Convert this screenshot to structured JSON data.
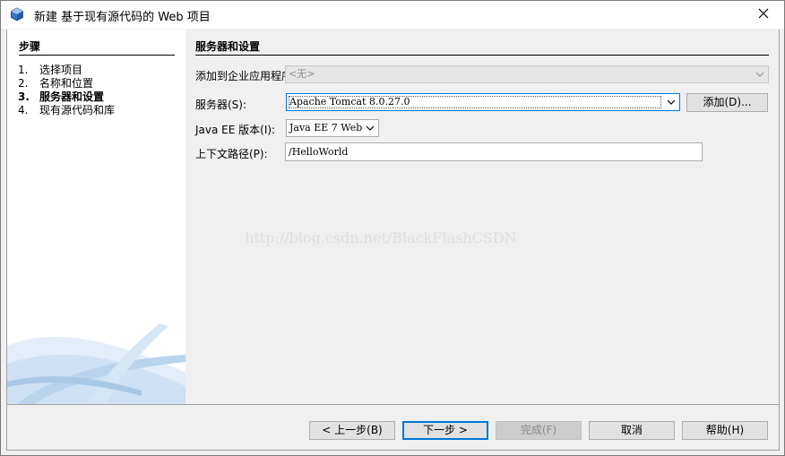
{
  "window": {
    "title": "新建 基于现有源代码的 Web 项目",
    "close_icon": "close-icon"
  },
  "steps": {
    "heading": "步骤",
    "items": [
      {
        "num": "1.",
        "label": "选择项目",
        "current": false
      },
      {
        "num": "2.",
        "label": "名称和位置",
        "current": false
      },
      {
        "num": "3.",
        "label": "服务器和设置",
        "current": true
      },
      {
        "num": "4.",
        "label": "现有源代码和库",
        "current": false
      }
    ]
  },
  "main": {
    "heading": "服务器和设置",
    "add_to_ear_label": "添加到企业应用程序(A):",
    "add_to_ear_value": "<无>",
    "server_label": "服务器(S):",
    "server_value": "Apache Tomcat 8.0.27.0",
    "add_button": "添加(D)...",
    "javaee_label": "Java EE 版本(I):",
    "javaee_value": "Java EE 7 Web",
    "context_label": "上下文路径(P):",
    "context_value": "/HelloWorld"
  },
  "watermark": "http://blog.csdn.net/BlackFlashCSDN",
  "footer": {
    "back": "< 上一步(B)",
    "next": "下一步 >",
    "finish": "完成(F)",
    "cancel": "取消",
    "help": "帮助(H)"
  },
  "colors": {
    "focus_border": "#0078d7",
    "panel_bg": "#f0f0f0"
  }
}
